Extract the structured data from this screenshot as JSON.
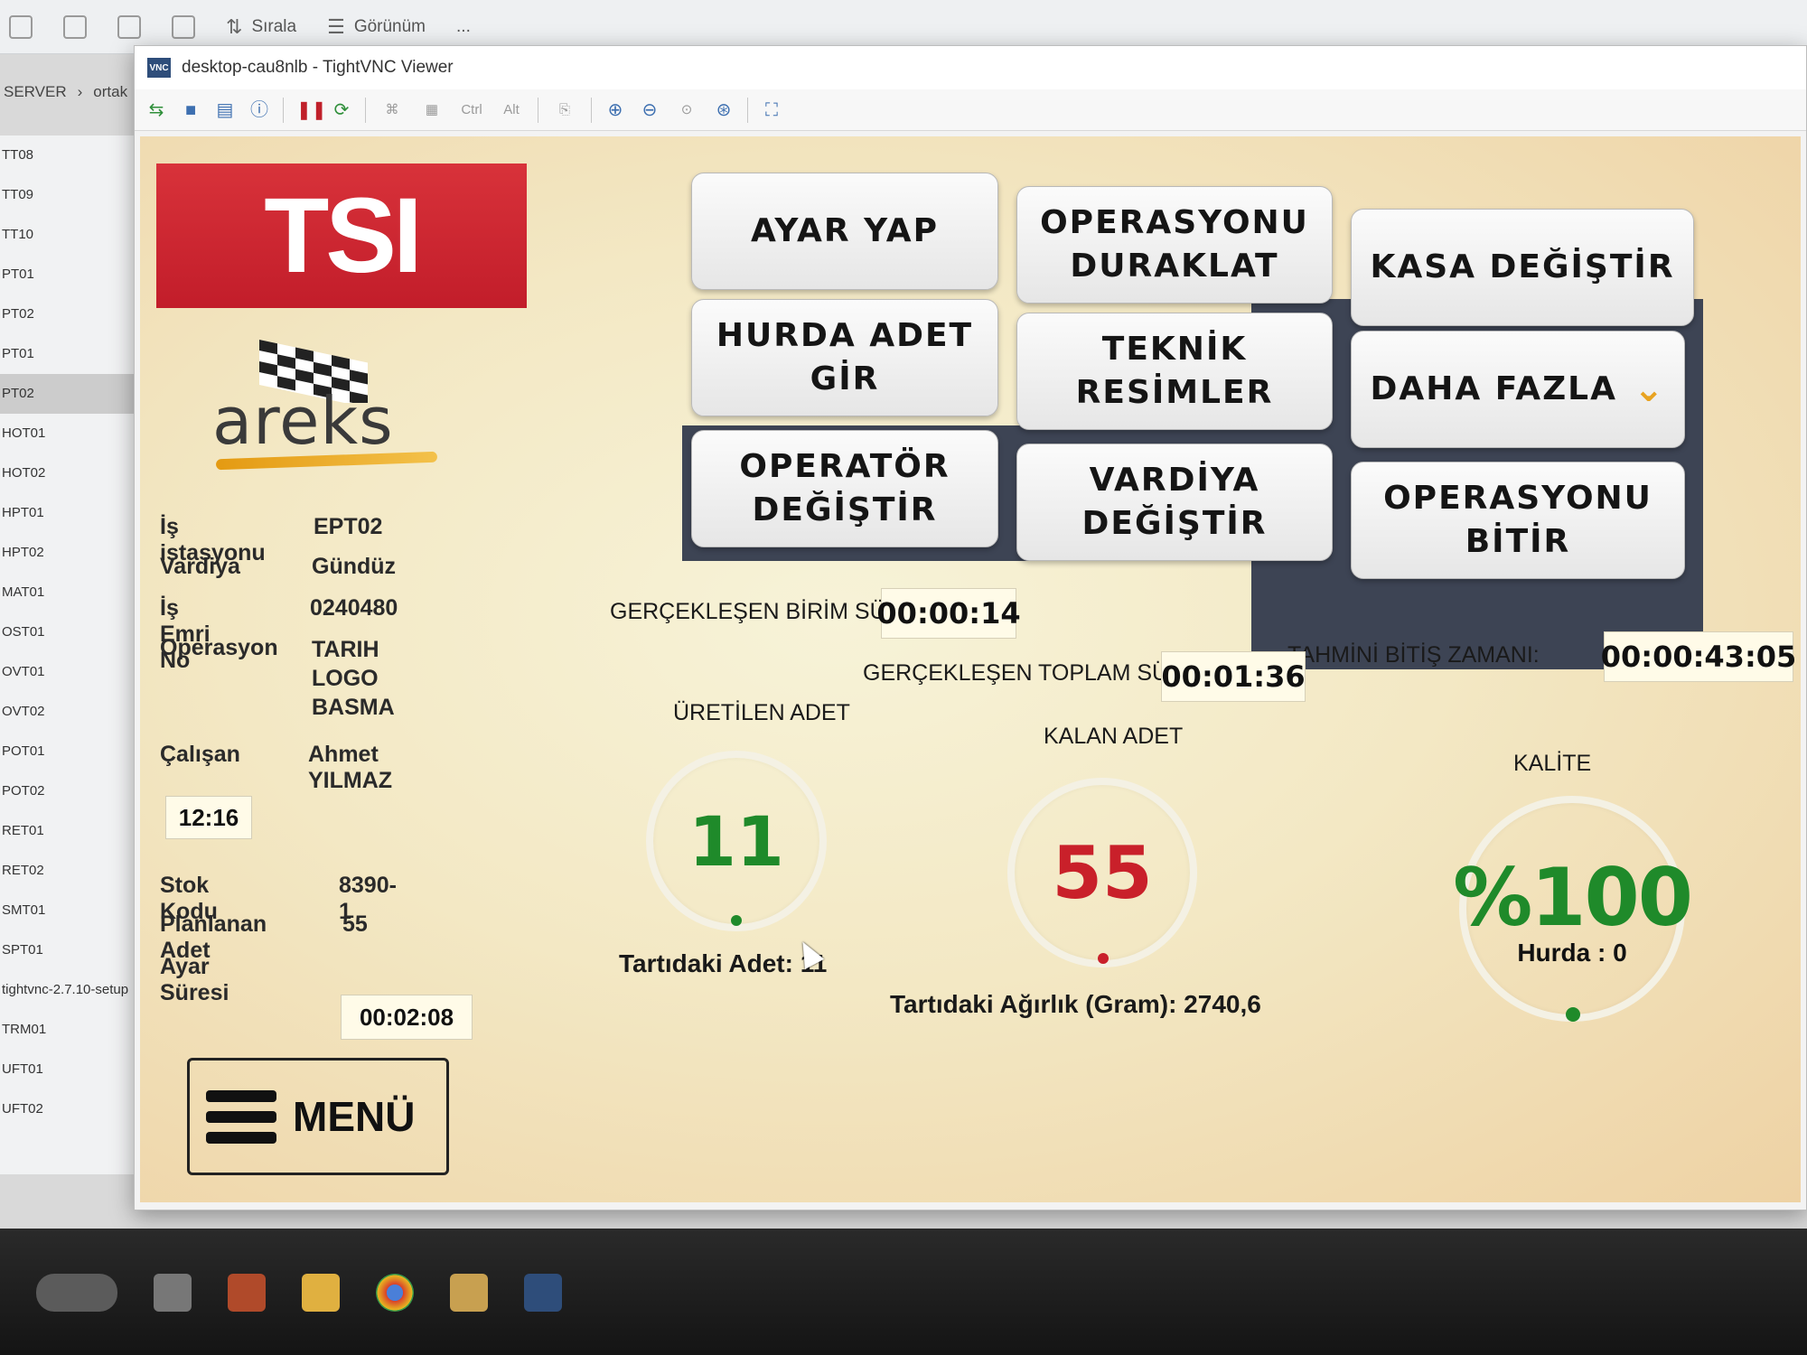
{
  "explorer": {
    "toolbar": {
      "sort_label": "Sırala",
      "view_label": "Görünüm",
      "more_label": "..."
    },
    "breadcrumb": [
      "SERVER",
      "ortak"
    ],
    "files": [
      "TT08",
      "TT09",
      "TT10",
      "PT01",
      "PT02",
      "PT01",
      "PT02",
      "HOT01",
      "HOT02",
      "HPT01",
      "HPT02",
      "MAT01",
      "OST01",
      "OVT01",
      "OVT02",
      "POT01",
      "POT02",
      "RET01",
      "RET02",
      "SMT01",
      "SPT01",
      "tightvnc-2.7.10-setup",
      "TRM01",
      "UFT01",
      "UFT02"
    ],
    "selected_index": 6
  },
  "vnc": {
    "title": "desktop-cau8nlb - TightVNC Viewer",
    "toolbar": {
      "ctrl_label": "Ctrl",
      "alt_label": "Alt"
    }
  },
  "app": {
    "logo_text": "TSI",
    "brand_text": "areks",
    "info": {
      "workstation_label": "İş istasyonu",
      "workstation_value": "EPT02",
      "shift_label": "Vardiya",
      "shift_value": "Gündüz",
      "workorder_label": "İş Emri No",
      "workorder_value": "0240480",
      "operation_label": "Operasyon",
      "operation_value": "TARIH LOGO\nBASMA",
      "employee_label": "Çalışan",
      "employee_value": "Ahmet YILMAZ",
      "clock": "12:16",
      "stock_label": "Stok Kodu",
      "stock_value": "8390-1",
      "planned_label": "Planlanan Adet",
      "planned_value": "55",
      "setup_label": "Ayar Süresi",
      "setup_value": "00:02:08"
    },
    "menu_label": "MENÜ",
    "buttons": {
      "ayar_yap": "AYAR YAP",
      "duraklat": "OPERASYONU\nDURAKLAT",
      "kasa": "KASA DEĞİŞTİR",
      "hurda": "HURDA ADET\nGİR",
      "teknik": "TEKNİK\nRESİMLER",
      "daha_fazla": "DAHA FAZLA",
      "operator": "OPERATÖR\nDEĞİŞTİR",
      "vardiya": "VARDİYA\nDEĞİŞTİR",
      "bitir": "OPERASYONU\nBİTİR"
    },
    "metrics": {
      "unit_time_label": "GERÇEKLEŞEN BİRİM SÜRE:",
      "unit_time_value": "00:00:14",
      "total_time_label": "GERÇEKLEŞEN TOPLAM SÜRE:",
      "total_time_value": "00:01:36",
      "finish_label": "TAHMİNİ BİTİŞ ZAMANI:",
      "finish_value": "00:00:43:05"
    },
    "gauges": {
      "produced_label": "ÜRETİLEN ADET",
      "produced_value": "11",
      "produced_caption": "Tartıdaki Adet: 11",
      "remaining_label": "KALAN ADET",
      "remaining_value": "55",
      "weight_caption": "Tartıdaki Ağırlık (Gram):  2740,6",
      "quality_label": "KALİTE",
      "quality_value": "%100",
      "scrap_caption": "Hurda : 0"
    },
    "colors": {
      "green": "#1f8a2a",
      "red": "#c9202a",
      "logo_red": "#c21d2a",
      "accent_orange": "#e8a321"
    }
  }
}
